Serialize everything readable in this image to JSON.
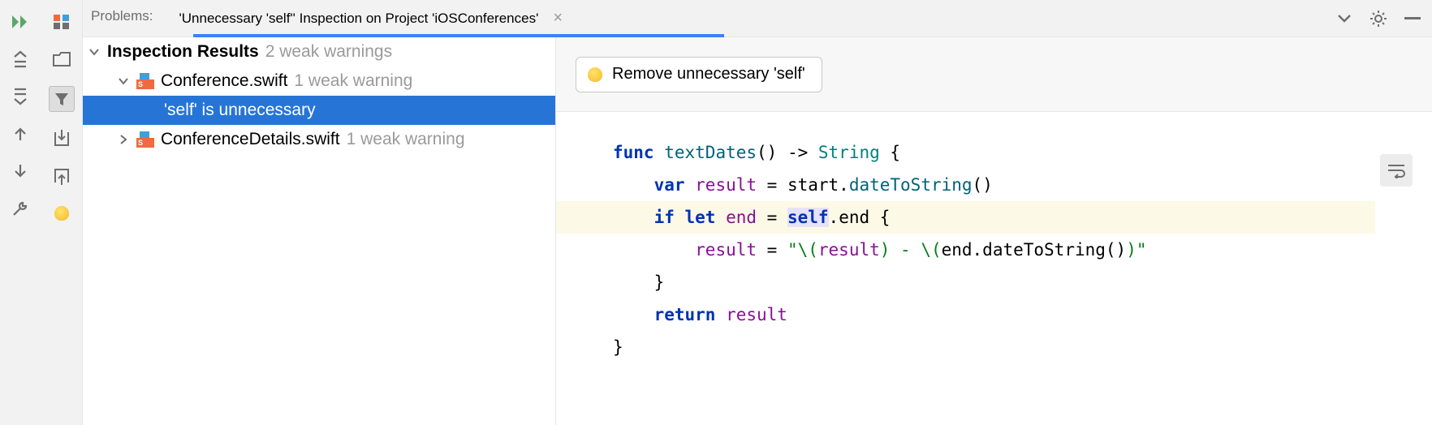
{
  "header": {
    "problems_label": "Problems:",
    "tab_title": "'Unnecessary 'self'' Inspection on Project 'iOSConferences'"
  },
  "tree": {
    "root_title": "Inspection Results",
    "root_subtitle": "2 weak warnings",
    "files": [
      {
        "name": "Conference.swift",
        "subtitle": "1 weak warning"
      },
      {
        "name": "ConferenceDetails.swift",
        "subtitle": "1 weak warning"
      }
    ],
    "issue_text": "'self' is unnecessary"
  },
  "fix": {
    "button_label": "Remove unnecessary 'self'"
  },
  "code": {
    "line1_func": "func",
    "line1_name": "textDates",
    "line1_tail": "() -> ",
    "line1_type": "String",
    "line1_brace": " {",
    "line2_var": "var",
    "line2_name": " result",
    "line2_eq": " = start.",
    "line2_call": "dateToString",
    "line2_tail": "()",
    "line3_if": "if",
    "line3_let": " let",
    "line3_end": " end",
    "line3_eq": " = ",
    "line3_self": "self",
    "line3_tail": ".end {",
    "line4_name": "result",
    "line4_eq": " = ",
    "line4_str_a": "\"\\(",
    "line4_res": "result",
    "line4_str_b": ") - \\(",
    "line4_call": "end.dateToString()",
    "line4_str_c": ")\"",
    "line5_brace": "}",
    "line6_return": "return",
    "line6_name": " result",
    "line7_brace": "}"
  }
}
